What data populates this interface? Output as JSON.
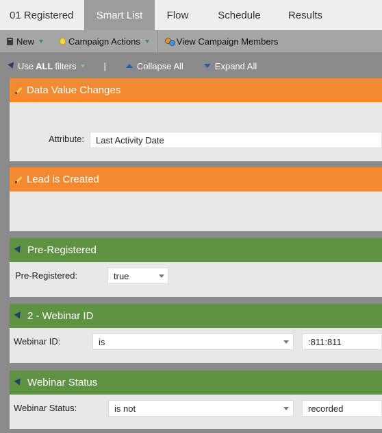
{
  "tabs": [
    {
      "label": "01 Registered"
    },
    {
      "label": "Smart List"
    },
    {
      "label": "Flow"
    },
    {
      "label": "Schedule"
    },
    {
      "label": "Results"
    }
  ],
  "toolbar": {
    "new_label": "New",
    "campaign_actions_label": "Campaign Actions",
    "view_members_label": "View Campaign Members"
  },
  "filterbar": {
    "use_prefix": "Use",
    "use_bold": "ALL",
    "use_suffix": "filters",
    "separator": "|",
    "collapse_label": "Collapse All",
    "expand_label": "Expand All"
  },
  "filters": [
    {
      "title": "Data Value Changes",
      "attribute_label": "Attribute:",
      "attribute_value": "Last Activity Date"
    },
    {
      "title": "Lead is Created"
    },
    {
      "title": "Pre-Registered",
      "field_label": "Pre-Registered:",
      "value": "true"
    },
    {
      "title": "2 -  Webinar ID",
      "field_label": "Webinar ID:",
      "operator": "is",
      "value": ":811:811"
    },
    {
      "title": "Webinar Status",
      "field_label": "Webinar Status:",
      "operator": "is not",
      "value": "recorded"
    }
  ],
  "colors": {
    "trigger_header": "#f38a31",
    "filter_header": "#5f9344",
    "active_tab": "#9c9c9c"
  }
}
